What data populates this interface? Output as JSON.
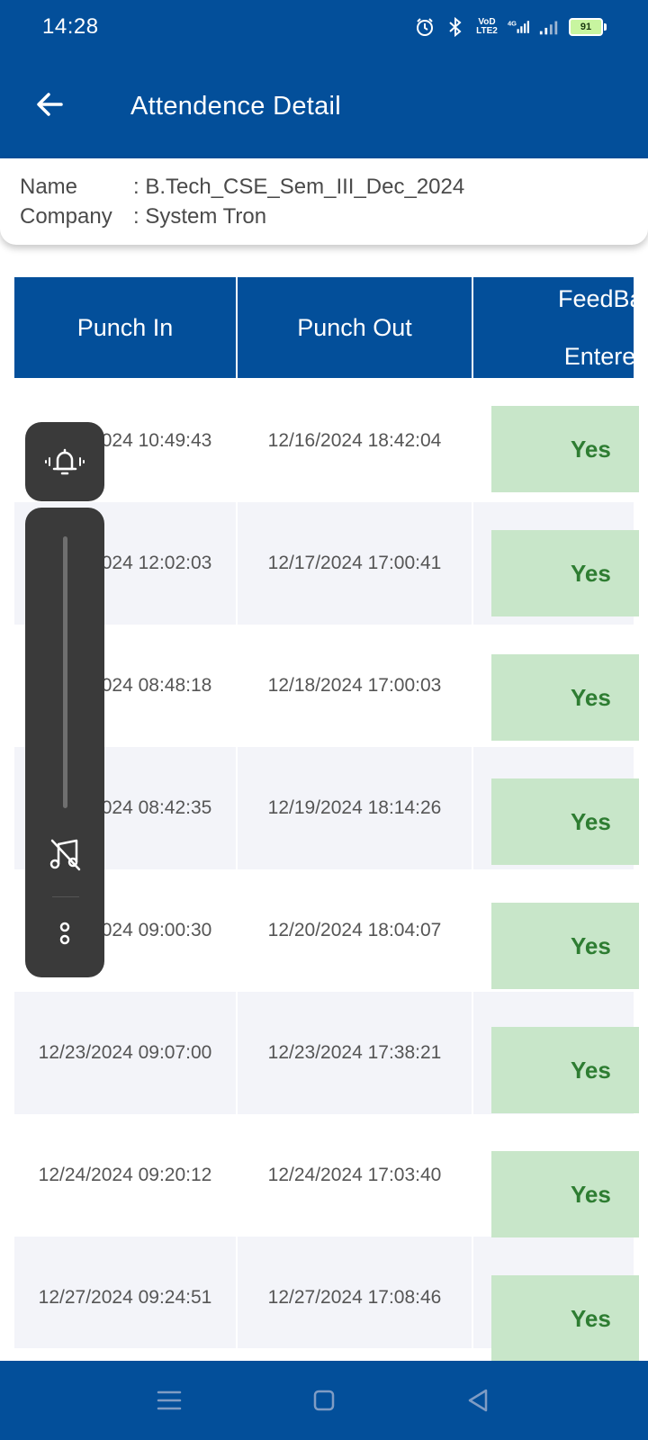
{
  "status_bar": {
    "time": "14:28",
    "icons": [
      "alarm-icon",
      "bluetooth-icon",
      "volte-icon",
      "4g-signal-icon",
      "signal-icon",
      "battery-icon"
    ],
    "volte_text": "VoD LTE2",
    "network_text": "4G",
    "battery_level": "91"
  },
  "app_bar": {
    "title": "Attendence Detail"
  },
  "info": {
    "name_label": "Name",
    "name_value": ": B.Tech_CSE_Sem_III_Dec_2024",
    "company_label": "Company",
    "company_value": ": System Tron"
  },
  "table": {
    "headers": [
      "Punch In",
      "Punch Out",
      "FeedBack Entered"
    ],
    "header_col3_line1": "FeedBac",
    "header_col3_line2": "Entered",
    "rows": [
      {
        "punch_in": "12/16/2024 10:49:43",
        "punch_out": "12/16/2024 18:42:04",
        "feedback": "Yes"
      },
      {
        "punch_in": "12/17/2024 12:02:03",
        "punch_out": "12/17/2024 17:00:41",
        "feedback": "Yes"
      },
      {
        "punch_in": "12/18/2024 08:48:18",
        "punch_out": "12/18/2024 17:00:03",
        "feedback": "Yes"
      },
      {
        "punch_in": "12/19/2024 08:42:35",
        "punch_out": "12/19/2024 18:14:26",
        "feedback": "Yes"
      },
      {
        "punch_in": "12/20/2024 09:00:30",
        "punch_out": "12/20/2024 18:04:07",
        "feedback": "Yes"
      },
      {
        "punch_in": "12/23/2024 09:07:00",
        "punch_out": "12/23/2024 17:38:21",
        "feedback": "Yes"
      },
      {
        "punch_in": "12/24/2024 09:20:12",
        "punch_out": "12/24/2024 17:03:40",
        "feedback": "Yes"
      },
      {
        "punch_in": "12/27/2024 09:24:51",
        "punch_out": "12/27/2024 17:08:46",
        "feedback": "Yes"
      }
    ]
  },
  "overlay": {
    "bell_icon": "ringing-bell-icon",
    "volume_slider_icon": "music-off-icon",
    "more_icon": "more-options-icon"
  },
  "nav_bar": {
    "buttons": [
      "menu-icon",
      "home-square-icon",
      "back-triangle-icon"
    ]
  },
  "colors": {
    "primary": "#034f9a",
    "yes_bg": "#c8e6c9",
    "yes_text": "#2e7d32",
    "row_alt": "#f3f4f9"
  }
}
